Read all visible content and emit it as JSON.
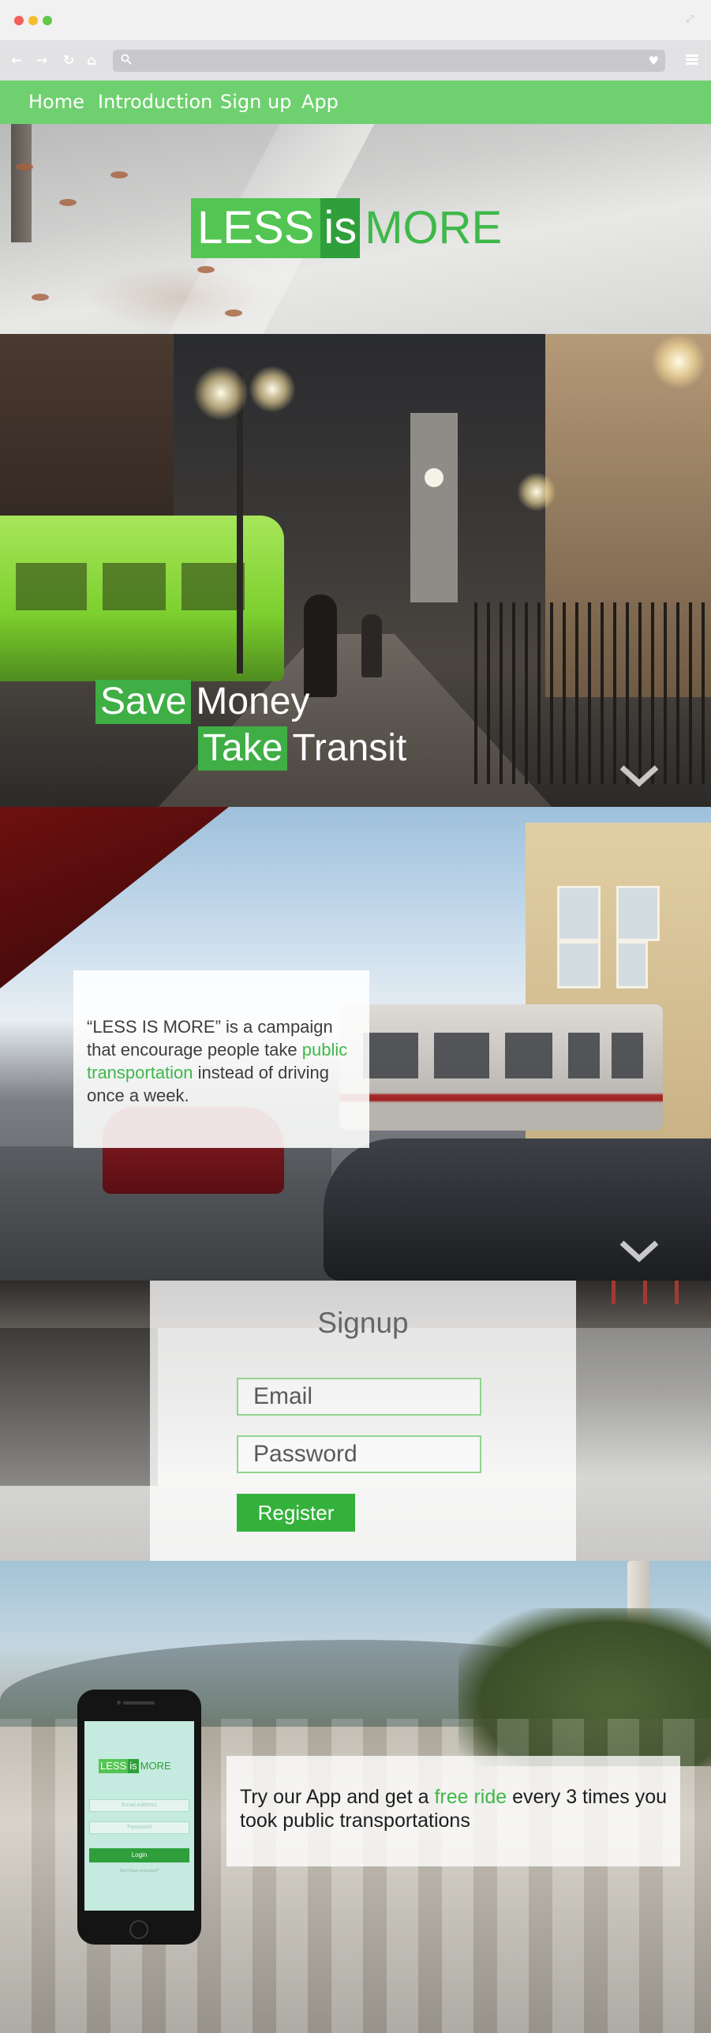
{
  "browser": {
    "icons": [
      "back-arrow-icon",
      "forward-arrow-icon",
      "reload-icon",
      "home-icon",
      "search-icon",
      "heart-icon",
      "hamburger-menu-icon",
      "expand-icon"
    ],
    "address_value": ""
  },
  "nav": {
    "items": [
      "Home",
      "Introduction",
      "Sign up",
      "App"
    ],
    "color": "#6fd06f"
  },
  "hero": {
    "logo_less": "LESS",
    "logo_is": "is",
    "logo_more": "MORE"
  },
  "slogan": {
    "line1_highlight": "Save",
    "line1_plain": "Money",
    "line2_highlight": "Take",
    "line2_plain": "Transit"
  },
  "campaign": {
    "text_before": "“LESS IS MORE” is a campaign that encourage people take ",
    "text_link": "public transportation",
    "text_after": " instead of driving once a week."
  },
  "signup": {
    "title": "Signup",
    "email_placeholder": "Email",
    "password_placeholder": "Password",
    "register_label": "Register"
  },
  "app": {
    "phone": {
      "logo_less": "LESS",
      "logo_is": "is",
      "logo_more": "MORE",
      "email_placeholder": "Email Address",
      "password_placeholder": "Password",
      "login_label": "Login",
      "link_text": "Don't have a account?"
    },
    "promo_before": "Try our App and get a ",
    "promo_highlight": "free ride",
    "promo_after": " every 3 times you took public transportations"
  },
  "colors": {
    "accent_green": "#3fb84a",
    "dark_green": "#2e9f3a",
    "light_green": "#53c553"
  }
}
